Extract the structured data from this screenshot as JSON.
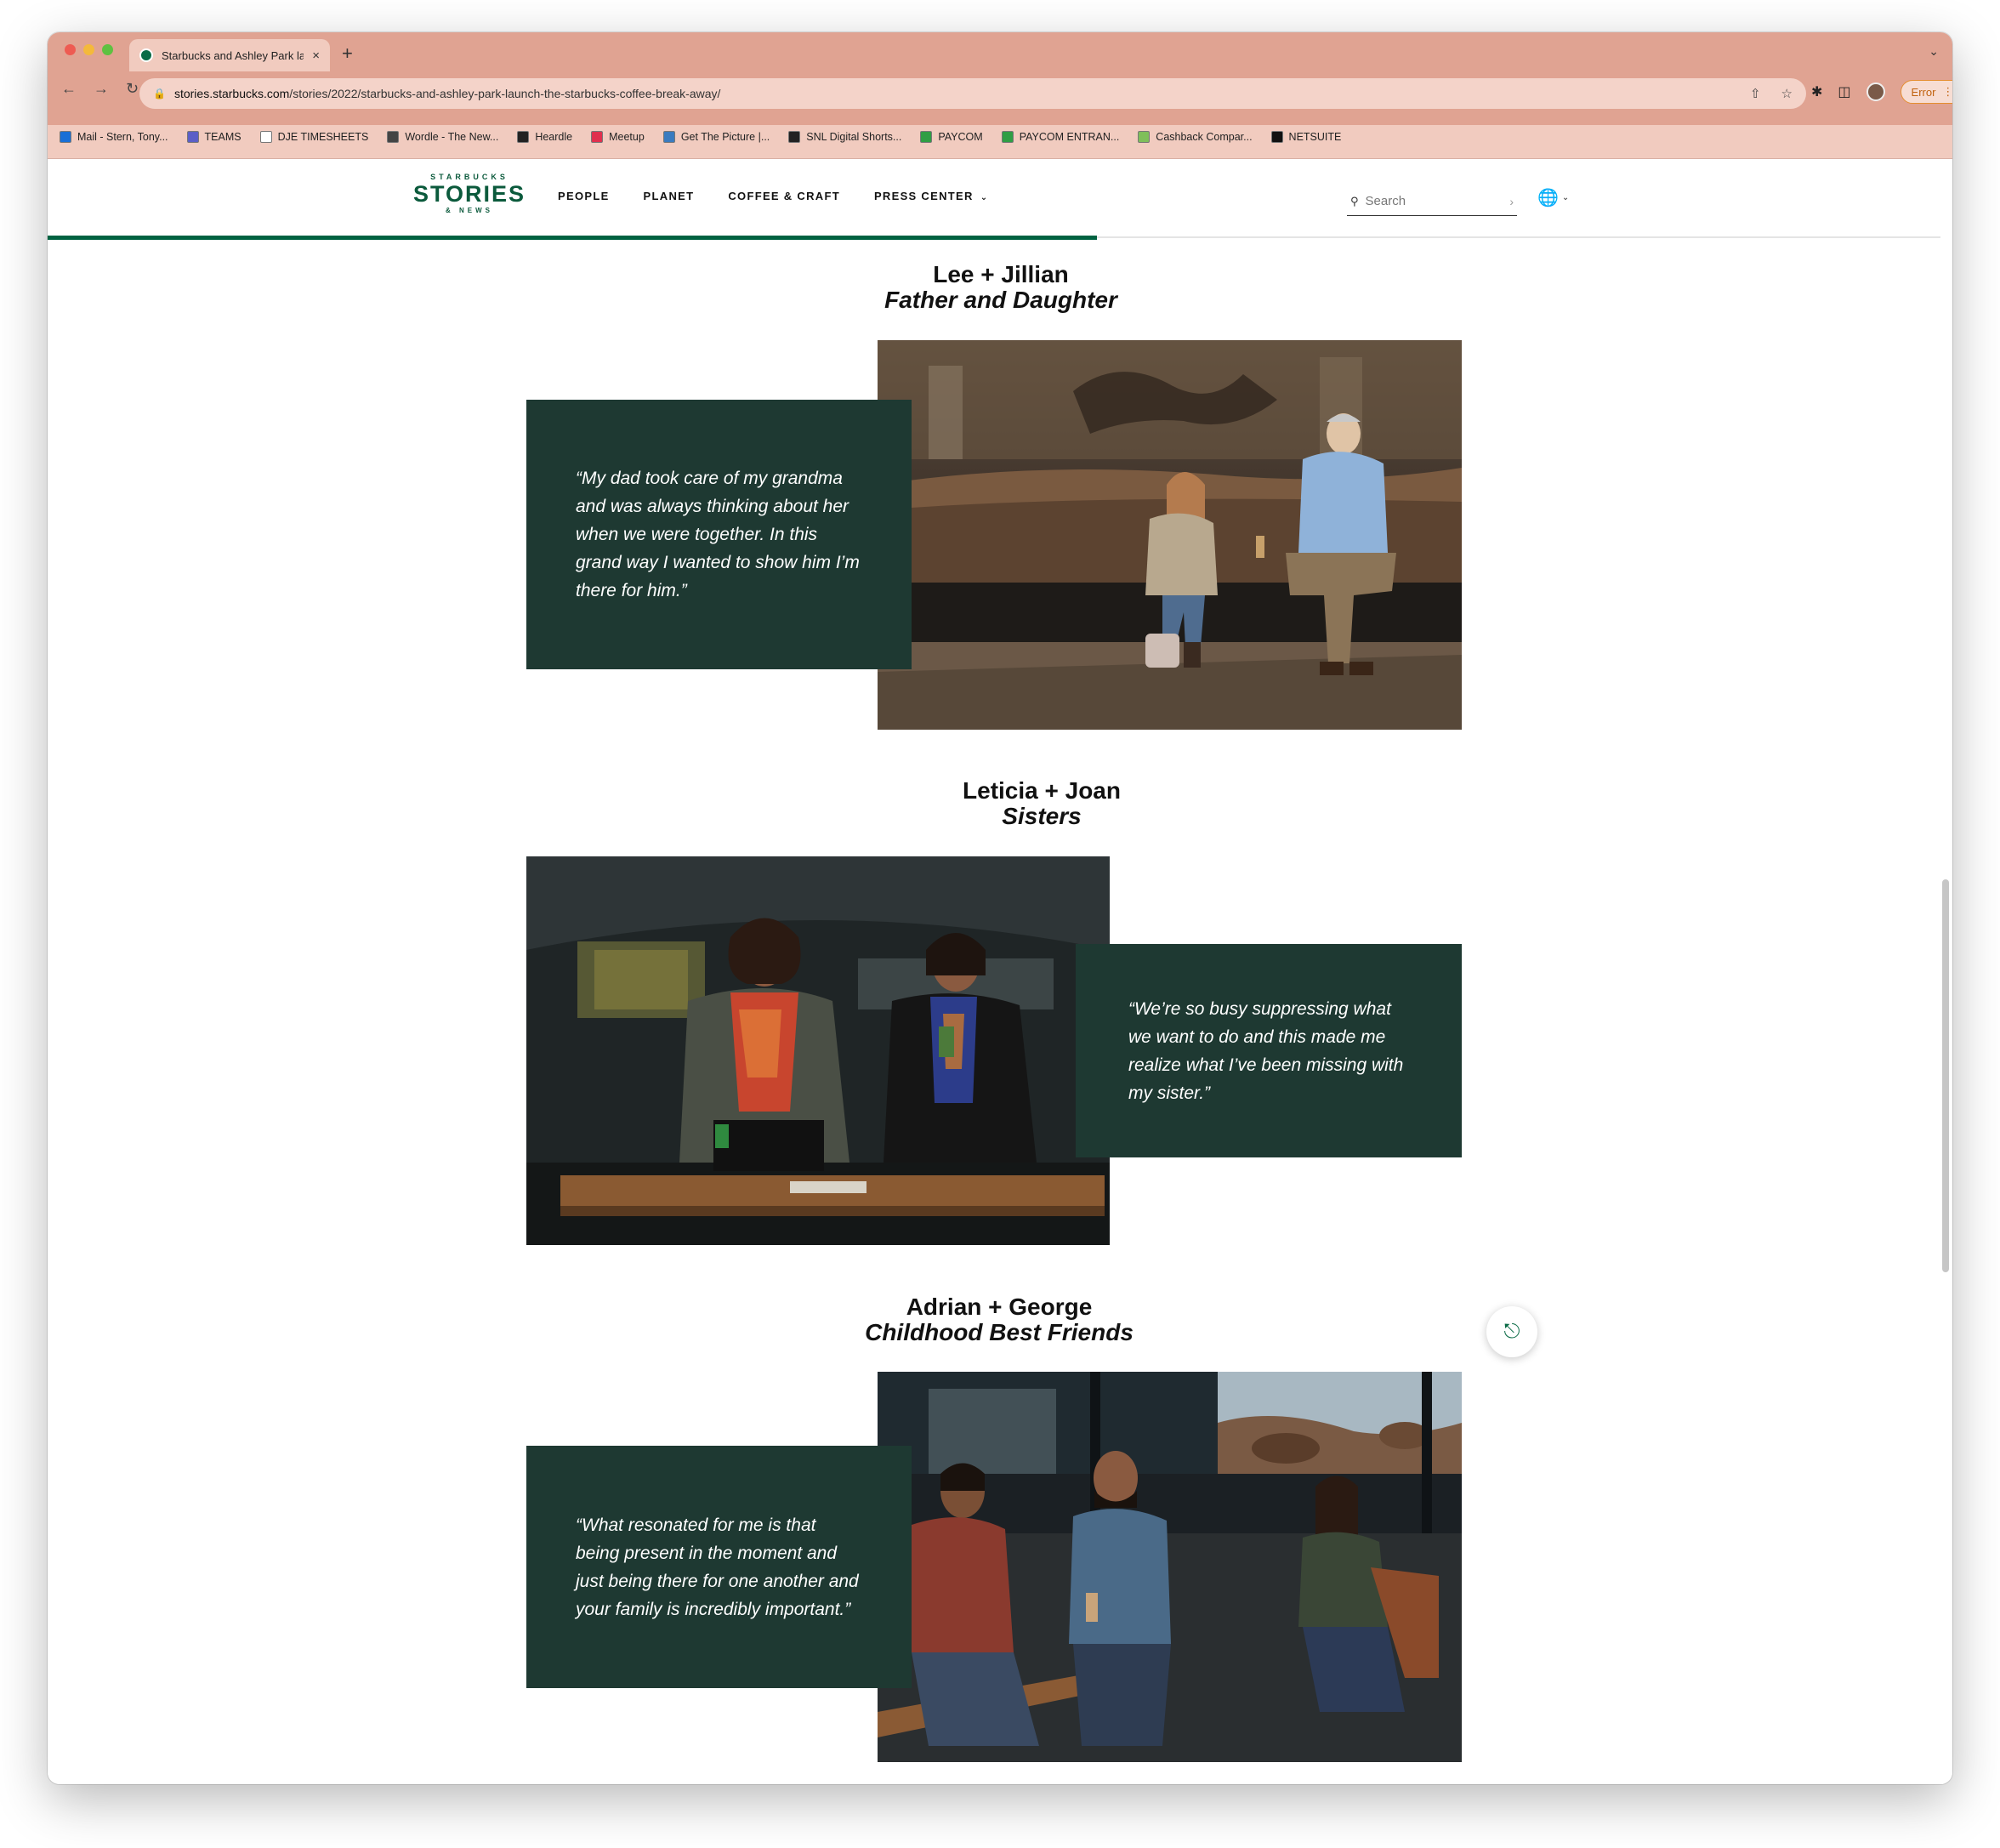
{
  "browser": {
    "tab_title": "Starbucks and Ashley Park lau",
    "tab_close": "×",
    "new_tab": "+",
    "tab_menu": "⌄",
    "url_host": "stories.starbucks.com",
    "url_path": "/stories/2022/starbucks-and-ashley-park-launch-the-starbucks-coffee-break-away/",
    "error_label": "Error",
    "bookmarks": [
      {
        "label": "Mail - Stern, Tony...",
        "color": "#1a6fd6"
      },
      {
        "label": "TEAMS",
        "color": "#5b5fc7"
      },
      {
        "label": "DJE TIMESHEETS",
        "color": "#ffffff"
      },
      {
        "label": "Wordle - The New...",
        "color": "#444444"
      },
      {
        "label": "Heardle",
        "color": "#222222"
      },
      {
        "label": "Meetup",
        "color": "#e0304e"
      },
      {
        "label": "Get The Picture |...",
        "color": "#3a7bbf"
      },
      {
        "label": "SNL Digital Shorts...",
        "color": "#222222"
      },
      {
        "label": "PAYCOM",
        "color": "#2f9e44"
      },
      {
        "label": "PAYCOM ENTRAN...",
        "color": "#2f9e44"
      },
      {
        "label": "Cashback Compar...",
        "color": "#7fbf5a"
      },
      {
        "label": "NETSUITE",
        "color": "#111111"
      }
    ]
  },
  "site": {
    "logo_top": "STARBUCKS",
    "logo_main": "STORIES",
    "logo_bottom": "& NEWS",
    "nav": [
      "PEOPLE",
      "PLANET",
      "COFFEE & CRAFT",
      "PRESS CENTER"
    ],
    "search_placeholder": "Search"
  },
  "sections": [
    {
      "names": "Lee + Jillian",
      "relation": "Father and Daughter",
      "quote": "“My dad took care of my grandma and was always thinking about her when we were together. In this grand way I wanted to show him I’m there for him.”"
    },
    {
      "names": "Leticia + Joan",
      "relation": "Sisters",
      "quote": "“We’re so busy suppressing what we want to do and this made me realize what I’ve been missing with my sister.”"
    },
    {
      "names": "Adrian + George",
      "relation": "Childhood Best Friends",
      "quote": "“What resonated for me is that being present in the moment and just being there for one another and your family is incredibly important.”"
    }
  ],
  "colors": {
    "quote_bg": "#1e3932",
    "brand_green": "#006241",
    "chrome_tab_strip": "#e0a392"
  }
}
